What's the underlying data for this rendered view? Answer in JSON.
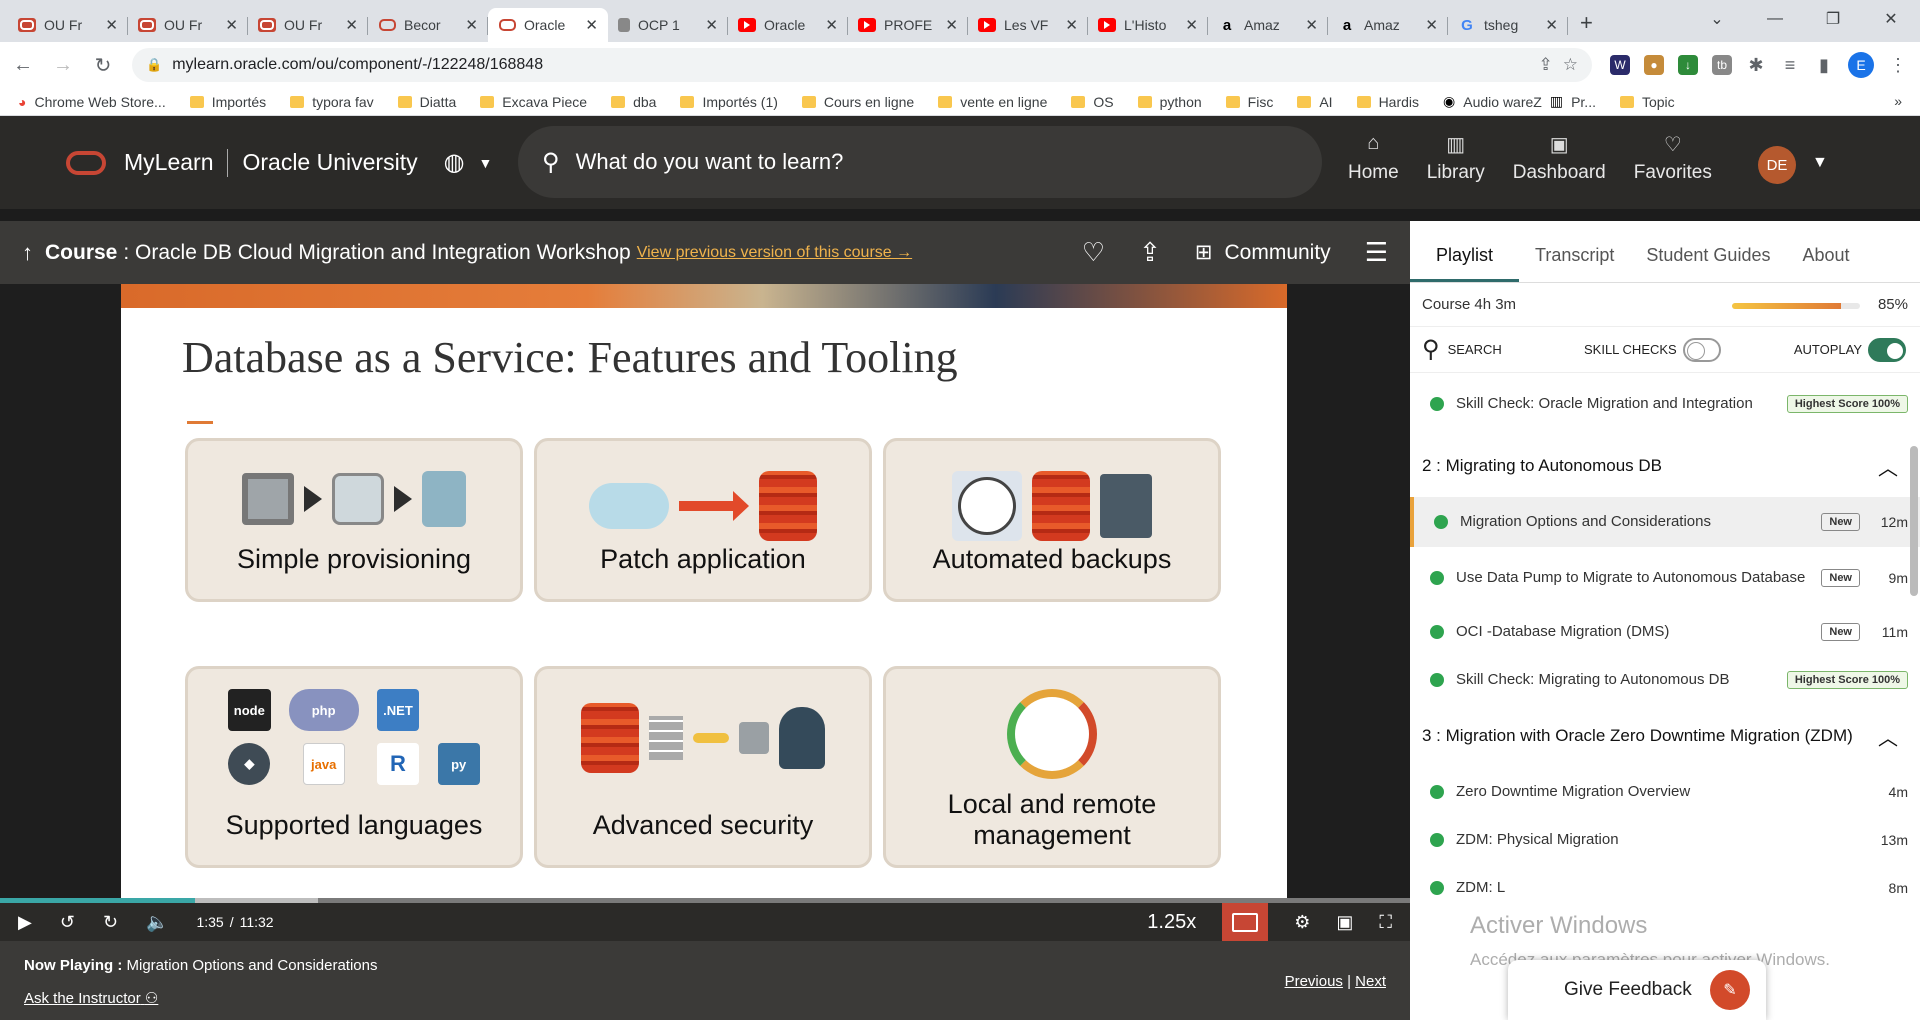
{
  "browser": {
    "tabs": [
      {
        "icon": "oracle",
        "title": "OU Fr"
      },
      {
        "icon": "oracle",
        "title": "OU Fr"
      },
      {
        "icon": "oracle",
        "title": "OU Fr"
      },
      {
        "icon": "oracle-o",
        "title": "Becor"
      },
      {
        "icon": "oracle-o",
        "title": "Oracle",
        "active": true
      },
      {
        "icon": "db",
        "title": "OCP 1"
      },
      {
        "icon": "yt",
        "title": "Oracle"
      },
      {
        "icon": "yt",
        "title": "PROFE"
      },
      {
        "icon": "yt",
        "title": "Les VF"
      },
      {
        "icon": "yt",
        "title": "L'Histo"
      },
      {
        "icon": "amz",
        "title": "Amaz"
      },
      {
        "icon": "amz",
        "title": "Amaz"
      },
      {
        "icon": "g",
        "title": "tsheg"
      }
    ],
    "url": "mylearn.oracle.com/ou/component/-/122248/168848",
    "profile_initial": "E",
    "bookmarks": [
      "Chrome Web Store...",
      "Importés",
      "typora fav",
      "Diatta",
      "Excava Piece",
      "dba",
      "Importés (1)",
      "Cours en ligne",
      "vente en ligne",
      "OS",
      "python",
      "Fisc",
      "AI",
      "Hardis",
      "Audio wareZ",
      "Pr...",
      "Topic"
    ]
  },
  "header": {
    "brand": "MyLearn",
    "subbrand": "Oracle University",
    "search_placeholder": "What do you want to learn?",
    "nav": [
      {
        "icon": "home-icon",
        "glyph": "⌂",
        "label": "Home"
      },
      {
        "icon": "library-icon",
        "glyph": "▥",
        "label": "Library"
      },
      {
        "icon": "dashboard-icon",
        "glyph": "▣",
        "label": "Dashboard"
      },
      {
        "icon": "heart-icon",
        "glyph": "♡",
        "label": "Favorites"
      }
    ],
    "user_initials": "DE"
  },
  "course": {
    "label": "Course",
    "name": ": Oracle DB Cloud Migration and Integration Workshop",
    "previous_link": "View previous version of this course →",
    "community": "Community"
  },
  "slide": {
    "title": "Database as a Service: Features and Tooling",
    "tiles": [
      "Simple provisioning",
      "Patch application",
      "Automated backups",
      "Supported languages",
      "Advanced security",
      "Local and remote management"
    ],
    "languages": [
      "node",
      "php",
      ".NET",
      "◆",
      "java",
      "R",
      "py"
    ]
  },
  "player": {
    "progress_fraction": 0.138,
    "time_current": "1:35",
    "time_sep": "/",
    "time_total": "11:32",
    "speed": "1.25x",
    "now_playing_label": "Now Playing :",
    "now_playing": "Migration Options and Considerations",
    "ask": "Ask the Instructor",
    "previous": "Previous",
    "next": "Next"
  },
  "panel": {
    "tabs": [
      "Playlist",
      "Transcript",
      "Student Guides",
      "About"
    ],
    "course_label": "Course",
    "course_duration": "4h 3m",
    "course_progress": 0.85,
    "course_pct": "85%",
    "search": "SEARCH",
    "skill_checks": "SKILL CHECKS",
    "autoplay": "AUTOPLAY",
    "items": [
      {
        "kind": "item",
        "title": "Skill Check: Oracle Migration and Integration",
        "badge": "Highest Score 100%",
        "dur": ""
      },
      {
        "kind": "section",
        "title": "2 :  Migrating to Autonomous DB"
      },
      {
        "kind": "item",
        "title": "Migration Options and Considerations",
        "badge": "New",
        "dur": "12m",
        "current": true
      },
      {
        "kind": "item",
        "title": "Use Data Pump to Migrate to Autonomous Database",
        "badge": "New",
        "dur": "9m"
      },
      {
        "kind": "item",
        "title": "OCI -Database Migration (DMS)",
        "badge": "New",
        "dur": "11m"
      },
      {
        "kind": "item",
        "title": "Skill Check: Migrating to Autonomous DB",
        "badge": "Highest Score 100%",
        "dur": ""
      },
      {
        "kind": "section",
        "title": "3 :  Migration with Oracle Zero Downtime Migration (ZDM)"
      },
      {
        "kind": "item",
        "title": "Zero Downtime Migration Overview",
        "badge": "",
        "dur": "4m"
      },
      {
        "kind": "item",
        "title": "ZDM: Physical Migration",
        "badge": "",
        "dur": "13m"
      },
      {
        "kind": "item",
        "title": "ZDM: L",
        "badge": "",
        "dur": "8m"
      }
    ]
  },
  "overlay": {
    "activate_title": "Activer Windows",
    "activate_sub": "Accédez aux paramètres pour activer Windows.",
    "feedback": "Give Feedback"
  }
}
